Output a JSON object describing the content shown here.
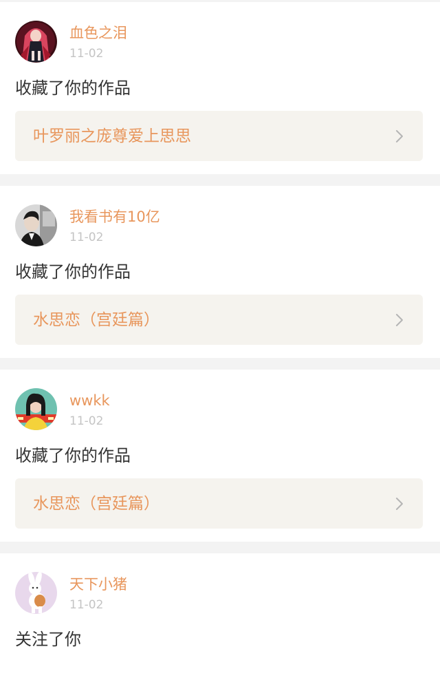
{
  "feed": {
    "items": [
      {
        "avatar_icon": "avatar-anime-girl-red",
        "username": "血色之泪",
        "date": "11-02",
        "action": "收藏了你的作品",
        "work_title": "叶罗丽之庞尊爱上思思"
      },
      {
        "avatar_icon": "avatar-man-photo",
        "username": "我看书有10亿",
        "date": "11-02",
        "action": "收藏了你的作品",
        "work_title": "水思恋（宫廷篇）"
      },
      {
        "avatar_icon": "avatar-girl-photo",
        "username": "wwkk",
        "date": "11-02",
        "action": "收藏了你的作品",
        "work_title": "水思恋（宫廷篇）"
      },
      {
        "avatar_icon": "avatar-rabbit-cartoon",
        "username": "天下小猪",
        "date": "11-02",
        "action": "关注了你"
      }
    ]
  },
  "colors": {
    "accent": "#e8965c",
    "date": "#c4c4c4",
    "text": "#333333",
    "link_bg": "#f5f3ee",
    "page_bg": "#f3f3f3"
  }
}
